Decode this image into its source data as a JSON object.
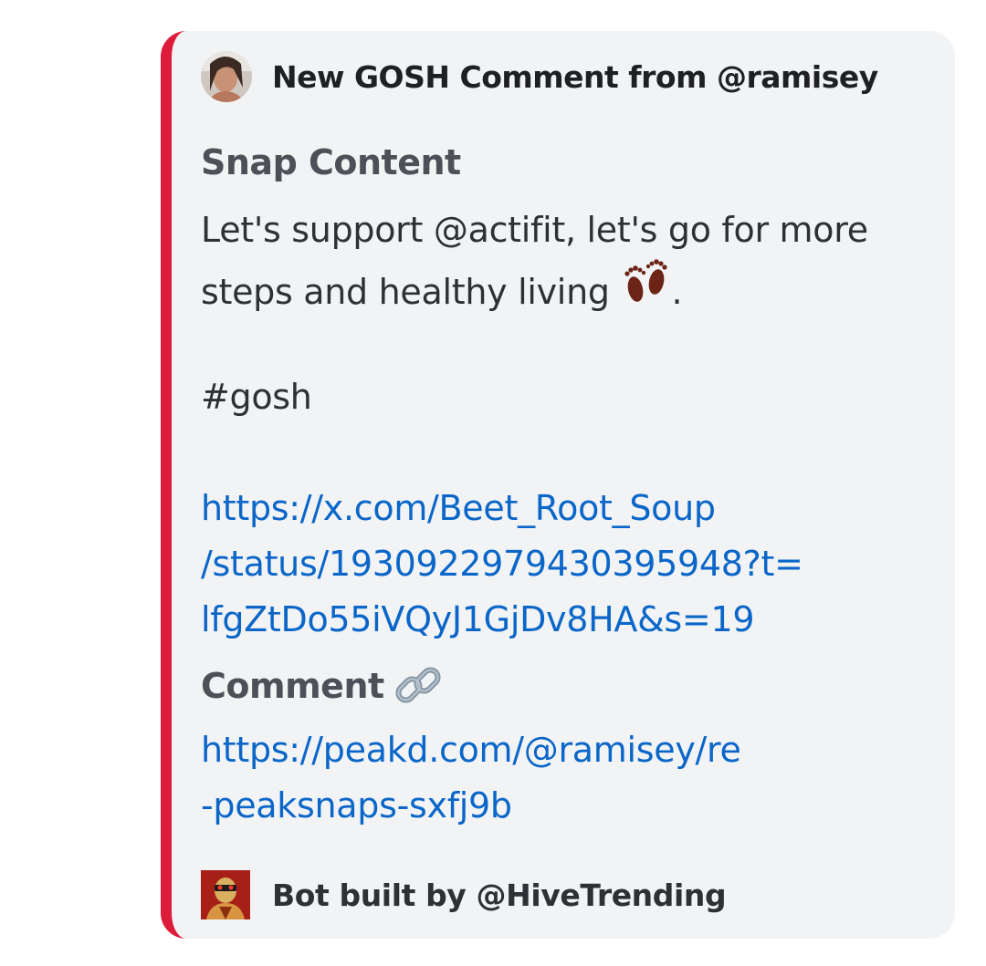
{
  "embed": {
    "accent_color": "#dd1b3b",
    "author": {
      "avatar": "user-avatar",
      "name": "New GOSH Comment from @ramisey"
    },
    "fields": {
      "snap": {
        "name": "Snap Content",
        "line1": "Let's support @actifit, let's go for more",
        "line2": "steps and healthy living",
        "emoji": "footprints-icon",
        "line2_end": ".",
        "hashtag": "#gosh",
        "link_line1": "https://x.com/Beet_Root_Soup",
        "link_line2": "/status/1930922979430395948?t=",
        "link_line3": "lfgZtDo55iVQyJ1GjDv8HA&s=19"
      },
      "comment": {
        "name": "Comment",
        "name_icon": "link-icon",
        "link_line1": "https://peakd.com/@ramisey/re",
        "link_line2": "-peaksnaps-sxfj9b"
      }
    },
    "footer": {
      "icon": "bot-avatar",
      "text": "Bot built by @HiveTrending"
    }
  }
}
